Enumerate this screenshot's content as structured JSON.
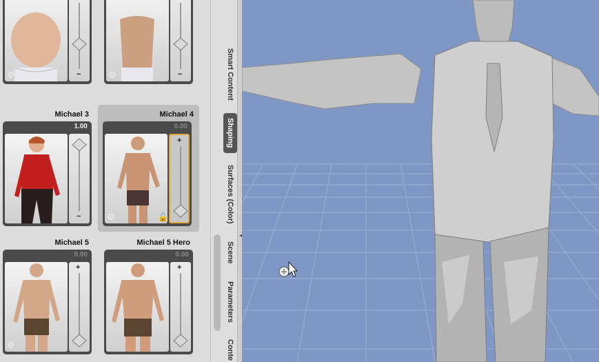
{
  "cards": [
    {
      "name": "",
      "value": "",
      "dimmed": true,
      "partial": true
    },
    {
      "name": "",
      "value": "",
      "dimmed": true,
      "partial": true
    },
    {
      "name": "Michael 3",
      "value": "1.00",
      "dimmed": false,
      "knob_fraction": 0.0
    },
    {
      "name": "Michael 4",
      "value": "0.00",
      "dimmed": true,
      "selected": true,
      "knob_fraction": 1.0
    },
    {
      "name": "Michael 5",
      "value": "0.00",
      "dimmed": true,
      "knob_fraction": 1.0
    },
    {
      "name": "Michael 5 Hero",
      "value": "0.00",
      "dimmed": true,
      "knob_fraction": 1.0
    }
  ],
  "tabs": [
    {
      "label": "Smart Content",
      "active": false
    },
    {
      "label": "Shaping",
      "active": true
    },
    {
      "label": "Surfaces (Color)",
      "active": false
    },
    {
      "label": "Scene",
      "active": false
    },
    {
      "label": "Parameters",
      "active": false
    },
    {
      "label": "Conte",
      "active": false
    }
  ],
  "colors": {
    "viewport_bg": "#7f97c4",
    "grid": "#9fb1d3",
    "model": "#c9c9c9",
    "active_slider": "#e0a83a",
    "shirt": "#c21f1f"
  },
  "icons": {
    "plus": "+",
    "minus": "−",
    "gear": "⚙",
    "lock": "🔓",
    "arrow": "◀"
  }
}
